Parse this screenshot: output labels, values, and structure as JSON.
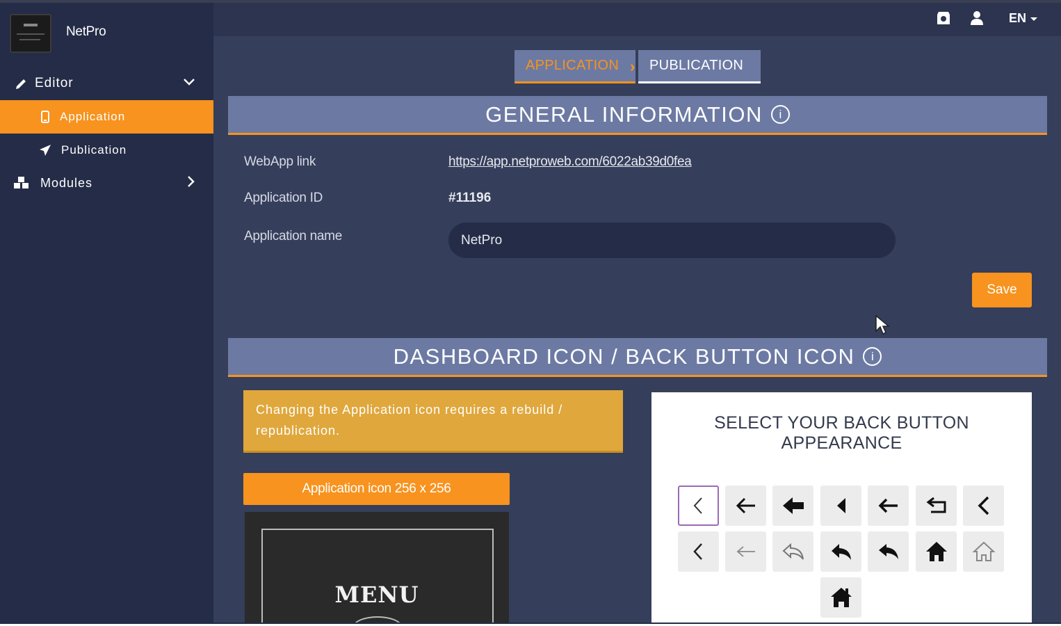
{
  "brand": {
    "name": "NetPro"
  },
  "sidebar": {
    "items": [
      {
        "label": "Editor",
        "icon": "pencil-icon"
      },
      {
        "label": "Application",
        "icon": "mobile-icon"
      },
      {
        "label": "Publication",
        "icon": "paper-plane-icon"
      },
      {
        "label": "Modules",
        "icon": "cubes-icon"
      }
    ]
  },
  "header": {
    "lang": "EN"
  },
  "tabs": {
    "application": "APPLICATION",
    "publication": "PUBLICATION"
  },
  "general": {
    "title": "GENERAL INFORMATION",
    "info_glyph": "i",
    "webapp_label": "WebApp link",
    "webapp_url": "https://app.netproweb.com/6022ab39d0fea",
    "app_id_label": "Application ID",
    "app_id": "#11196",
    "app_name_label": "Application name",
    "app_name_value": "NetPro",
    "save": "Save"
  },
  "dashboard": {
    "title": "DASHBOARD ICON / BACK BUTTON ICON",
    "notice": "Changing the Application icon requires a rebuild / republication.",
    "icon_button": "Application icon 256 x 256",
    "preview_text": "MENU"
  },
  "back_panel": {
    "title_line1": "SELECT YOUR BACK BUTTON",
    "title_line2": "APPEARANCE"
  },
  "colors": {
    "accent": "#f7931e",
    "sidebar": "#242c47",
    "content": "#353e5a",
    "section": "#6c7aa3"
  }
}
